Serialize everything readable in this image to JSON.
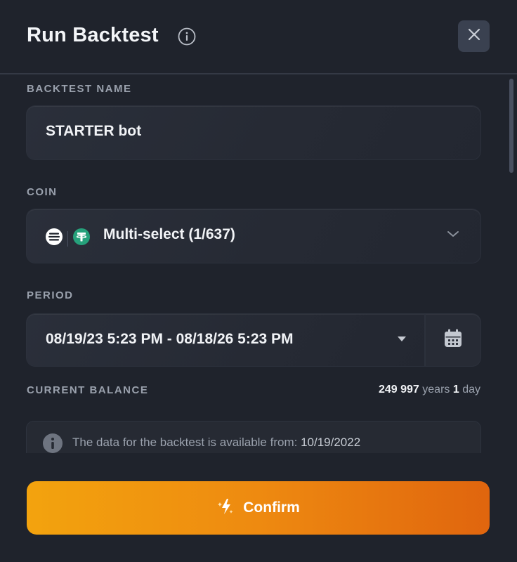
{
  "dialog": {
    "title": "Run Backtest",
    "close_icon": "close-icon",
    "info_icon": "info-icon"
  },
  "fields": {
    "name": {
      "label": "BACKTEST NAME",
      "value": "STARTER bot"
    },
    "coin": {
      "label": "COIN",
      "value": "Multi-select (1/637)",
      "icons": [
        "exchange-icon",
        "tether-icon"
      ]
    },
    "period": {
      "label": "PERIOD",
      "value": "08/19/23 5:23 PM - 08/18/26 5:23 PM",
      "calendar_icon": "calendar-icon"
    }
  },
  "balance": {
    "label": "CURRENT BALANCE",
    "years_value": "249 997",
    "years_unit": "years",
    "days_value": "1",
    "days_unit": "day"
  },
  "notice": {
    "text": "The data for the backtest is available from:",
    "date": "10/19/2022"
  },
  "actions": {
    "confirm_label": "Confirm"
  },
  "colors": {
    "background": "#1f232c",
    "accent_start": "#f3a30e",
    "accent_end": "#e0650e",
    "tether_green": "#26a17b"
  }
}
